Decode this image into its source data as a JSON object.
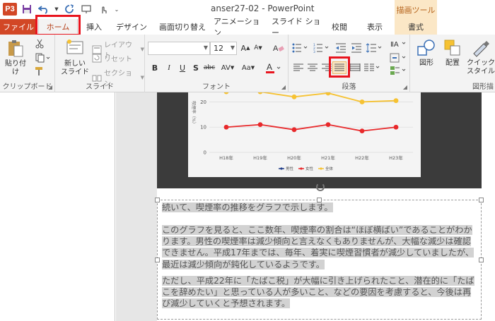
{
  "titlebar": {
    "app_icon": "P3",
    "document_title": "anser27-02 - PowerPoint",
    "context_tab_group": "描画ツール"
  },
  "tabs": [
    "ファイル",
    "ホーム",
    "挿入",
    "デザイン",
    "画面切り替え",
    "アニメーション",
    "スライド ショー",
    "校閲",
    "表示",
    "書式"
  ],
  "ribbon": {
    "clipboard": {
      "paste": "貼り付け",
      "label": "クリップボード"
    },
    "slide": {
      "new_slide_line1": "新しい",
      "new_slide_line2": "スライド",
      "layout": "レイアウト",
      "reset": "リセット",
      "section": "セクション",
      "label": "スライド"
    },
    "font": {
      "font_name": "",
      "font_size": "12",
      "label": "フォント"
    },
    "paragraph": {
      "label": "段落"
    },
    "drawing": {
      "shapes": "図形",
      "arrange": "配置",
      "quick_styles_line1": "クイック",
      "quick_styles_line2": "スタイル",
      "label": "図形描"
    }
  },
  "chart": {
    "chart_data": {
      "type": "line",
      "categories": [
        "H18年",
        "H19年",
        "H20年",
        "H21年",
        "H22年",
        "H23年"
      ],
      "series": [
        {
          "name": "男性",
          "values": [
            null,
            null,
            null,
            null,
            null,
            null
          ]
        },
        {
          "name": "女性",
          "values": [
            10,
            11,
            9,
            11,
            8.5,
            10
          ]
        },
        {
          "name": "全体",
          "values": [
            24,
            24,
            22,
            23.5,
            20,
            20.5
          ]
        }
      ],
      "yticks": [
        "0",
        "10",
        "20"
      ],
      "ylabel": "喫煙率（%）",
      "ylim": [
        0,
        26
      ],
      "colors": {
        "男性": "#1f3c88",
        "女性": "#e8292b",
        "全体": "#f6c232"
      },
      "legend": "bottom"
    }
  },
  "textbox": {
    "p1": "続いて、喫煙率の推移をグラフで示します。",
    "p2": "このグラフを見ると、ここ数年、喫煙率の割合は“ほぼ横ばい”であることがわかります。男性の喫煙率は減少傾向と言えなくもありませんが、大幅な減少は確認できません。平成17年までは、毎年、着実に喫煙習慣者が減少していましたが、最近は減少傾向が鈍化しているようです。",
    "p3": "ただし、平成22年に「たばこ税」が大幅に引き上げられたこと、潜在的に「たばこを辞めたい」と思っている人が多いこと、などの要因を考慮すると、今後は再び減少していくと予想されます。"
  }
}
